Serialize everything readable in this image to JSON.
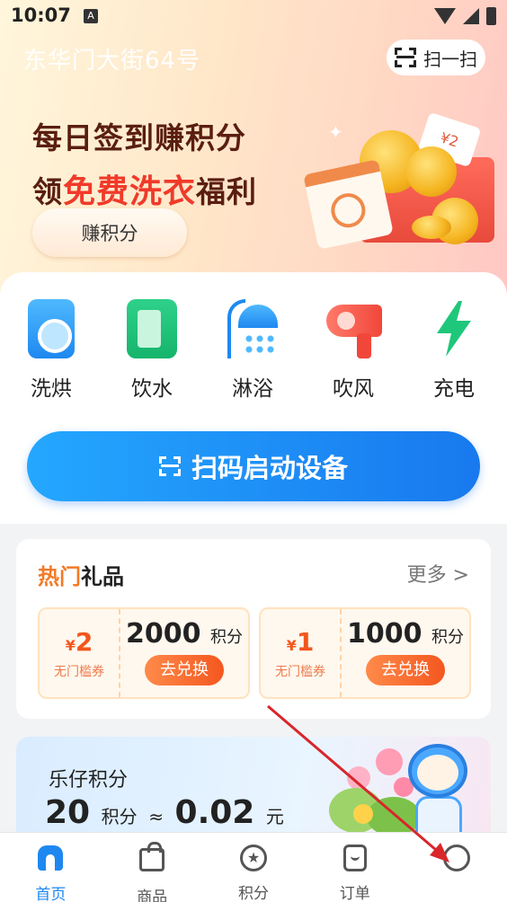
{
  "status_bar": {
    "time": "10:07",
    "badge": "A"
  },
  "header": {
    "address": "东华门大街64号",
    "scan_label": "扫一扫"
  },
  "promo": {
    "line1": "每日签到赚积分",
    "line2_prefix": "领",
    "line2_highlight": "免费洗衣",
    "line2_suffix": "福利",
    "button_label": "赚积分",
    "ticket_text": "¥2"
  },
  "services": [
    {
      "label": "洗烘",
      "icon": "washer-icon"
    },
    {
      "label": "饮水",
      "icon": "water-dispenser-icon"
    },
    {
      "label": "淋浴",
      "icon": "shower-icon"
    },
    {
      "label": "吹风",
      "icon": "hair-dryer-icon"
    },
    {
      "label": "充电",
      "icon": "lightning-icon"
    }
  ],
  "scan_button": {
    "label": "扫码启动设备"
  },
  "gifts": {
    "title_hot": "热门",
    "title_rest": "礼品",
    "more": "更多 >",
    "coupons": [
      {
        "currency": "¥",
        "amount": "2",
        "desc": "无门槛券",
        "points": "2000",
        "unit": "积分",
        "action": "去兑换"
      },
      {
        "currency": "¥",
        "amount": "1",
        "desc": "无门槛券",
        "points": "1000",
        "unit": "积分",
        "action": "去兑换"
      }
    ]
  },
  "points": {
    "title": "乐仔积分",
    "value": "20",
    "unit": "积分",
    "approx": "≈",
    "money": "0.02",
    "money_unit": "元"
  },
  "nav": [
    {
      "label": "首页",
      "icon": "home-icon",
      "active": true
    },
    {
      "label": "商品",
      "icon": "shopping-bag-icon",
      "active": false
    },
    {
      "label": "积分",
      "icon": "points-star-icon",
      "active": false
    },
    {
      "label": "订单",
      "icon": "order-icon",
      "active": false
    },
    {
      "label": "",
      "icon": "profile-icon",
      "active": false
    }
  ],
  "colors": {
    "accent_blue": "#1e88f0",
    "promo_red": "#f03a2a",
    "coupon_orange": "#f2561d",
    "annotation_arrow": "#d8262b"
  }
}
